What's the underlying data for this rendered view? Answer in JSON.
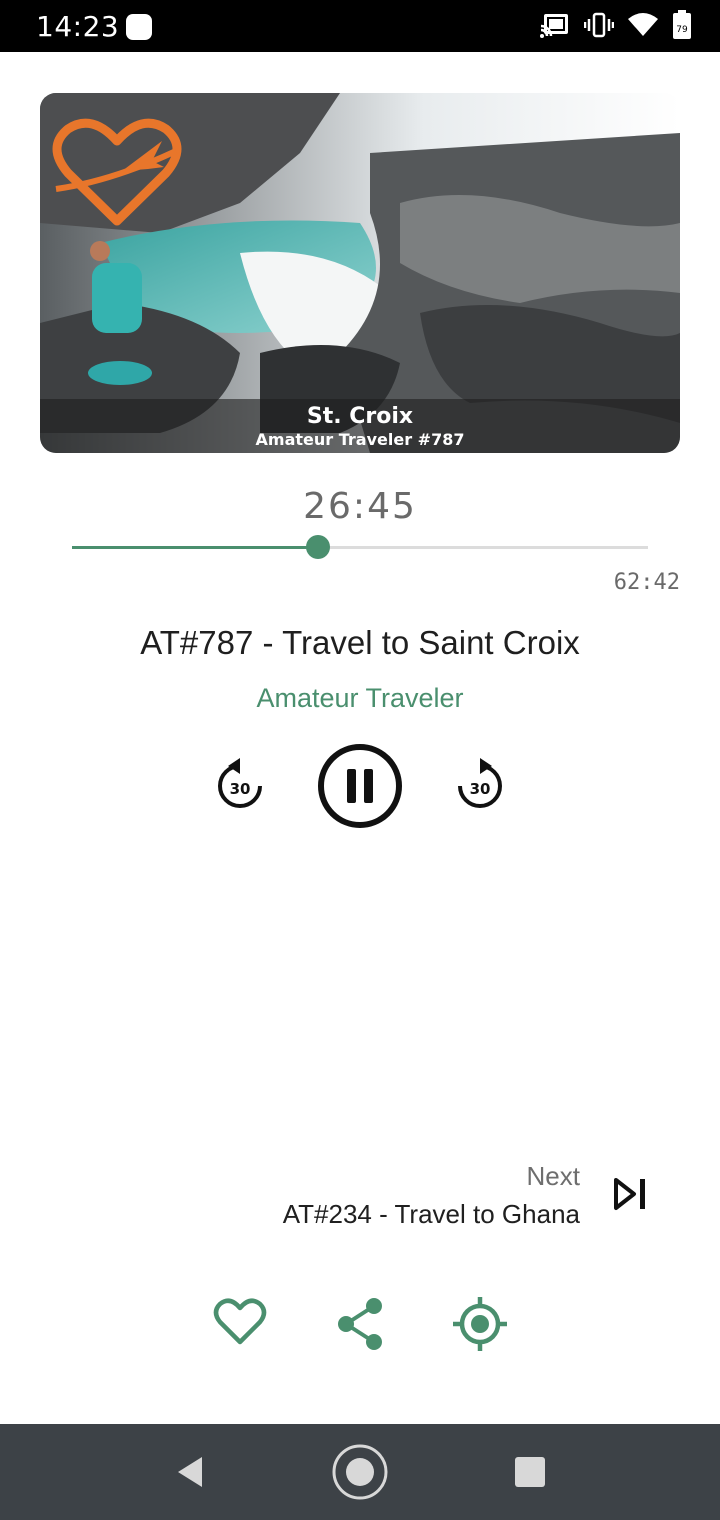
{
  "status_bar": {
    "time": "14:23",
    "battery_level": "79",
    "icons": [
      "cast-icon",
      "vibrate-icon",
      "wifi-icon",
      "battery-icon"
    ]
  },
  "artwork": {
    "title": "St. Croix",
    "subtitle": "Amateur Traveler #787",
    "logo": "amateur-traveler-heart-plane-logo"
  },
  "player": {
    "elapsed": "26:45",
    "duration": "62:42",
    "progress_fraction": 0.427,
    "skip_back_seconds": "30",
    "skip_forward_seconds": "30",
    "state": "playing"
  },
  "episode": {
    "title": "AT#787 - Travel to Saint Croix",
    "podcast": "Amateur Traveler"
  },
  "next": {
    "label": "Next",
    "title": "AT#234 - Travel to Ghana"
  },
  "actions": [
    "heart-icon",
    "share-icon",
    "locate-icon"
  ],
  "colors": {
    "accent": "#4a8f6e",
    "nav_bar": "#3d4247",
    "status_bar": "#000000",
    "logo_orange": "#e8762b"
  }
}
